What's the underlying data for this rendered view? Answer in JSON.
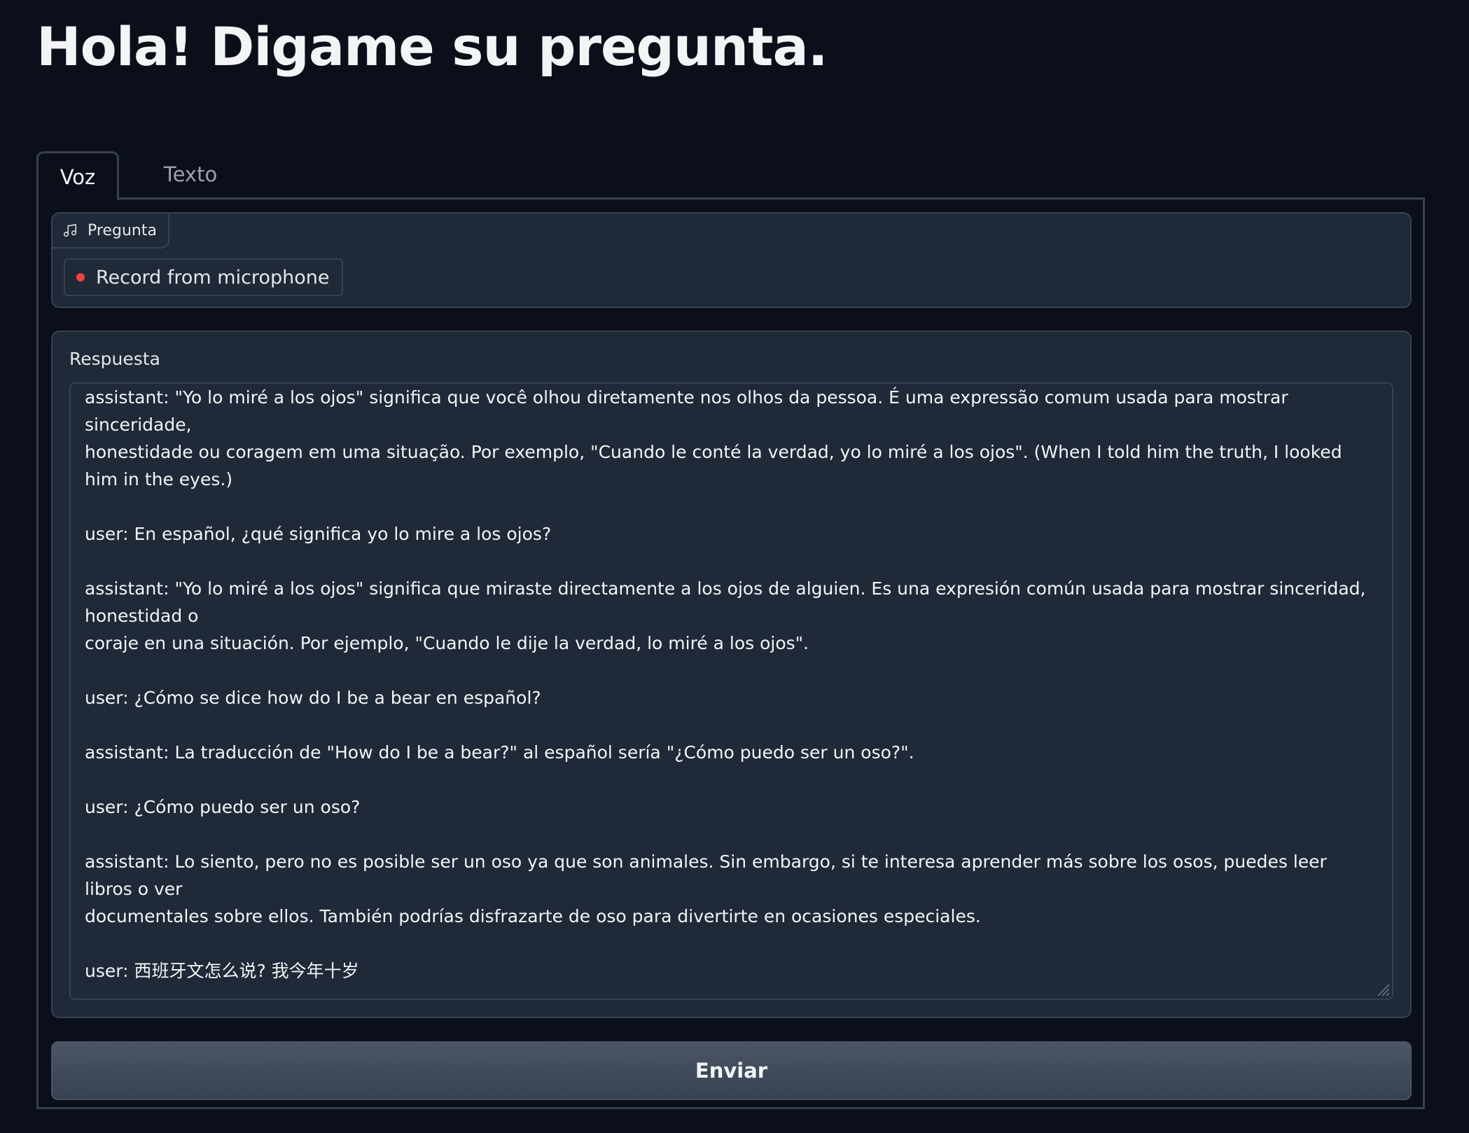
{
  "header": {
    "title": "Hola! Digame su pregunta."
  },
  "tabs": [
    {
      "label": "Voz",
      "active": true
    },
    {
      "label": "Texto",
      "active": false
    }
  ],
  "audio_input": {
    "label": "Pregunta",
    "icon": "music-icon",
    "record_button": "Record from microphone",
    "record_dot_color": "#ef4444"
  },
  "response": {
    "label": "Respuesta",
    "text": "assistant: \"Yo lo miré a los ojos\" significa que você olhou diretamente nos olhos da pessoa. É uma expressão comum usada para mostrar sinceridade,\nhonestidade ou coragem em uma situação. Por exemplo, \"Cuando le conté la verdad, yo lo miré a los ojos\". (When I told him the truth, I looked him in the eyes.)\n\nuser: En español, ¿qué significa yo lo mire a los ojos?\n\nassistant: \"Yo lo miré a los ojos\" significa que miraste directamente a los ojos de alguien. Es una expresión común usada para mostrar sinceridad, honestidad o\ncoraje en una situación. Por ejemplo, \"Cuando le dije la verdad, lo miré a los ojos\".\n\nuser: ¿Cómo se dice how do I be a bear en español?\n\nassistant: La traducción de \"How do I be a bear?\" al español sería \"¿Cómo puedo ser un oso?\".\n\nuser: ¿Cómo puedo ser un oso?\n\nassistant: Lo siento, pero no es posible ser un oso ya que son animales. Sin embargo, si te interesa aprender más sobre los osos, puedes leer libros o ver\ndocumentales sobre ellos. También podrías disfrazarte de oso para divertirte en ocasiones especiales.\n\nuser: 西班牙文怎么说? 我今年十岁\n\nassistant: \"我今年十岁\" 在西班牙语中是 \"Tengo diez años este año\"."
  },
  "submit": {
    "label": "Enviar"
  }
}
